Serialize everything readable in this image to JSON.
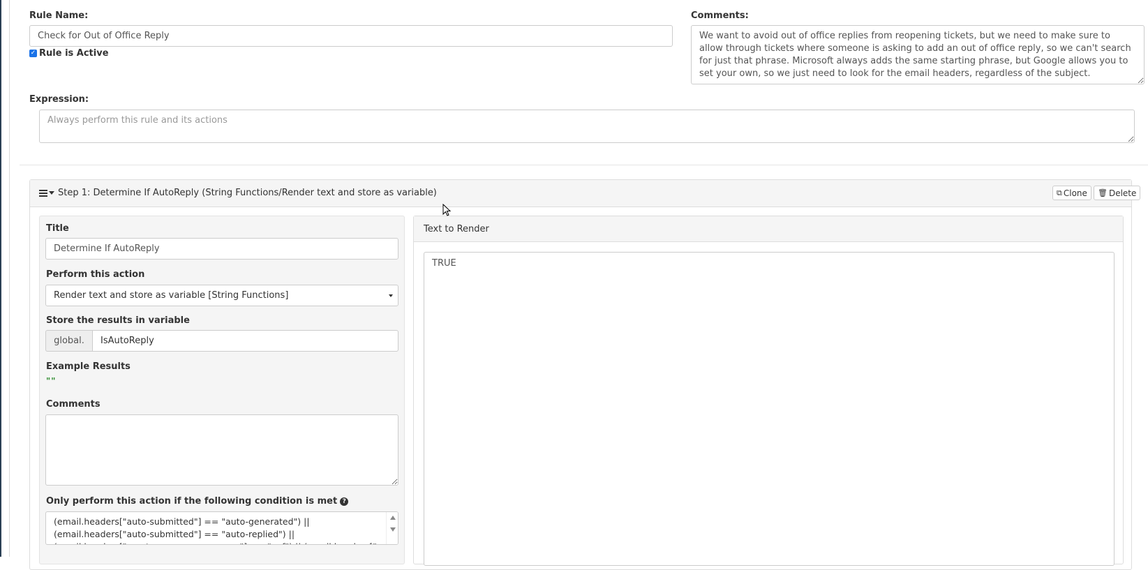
{
  "rule": {
    "name_label": "Rule Name:",
    "name_value": "Check for Out of Office Reply",
    "active_label": "Rule is Active",
    "active_checked": true,
    "comments_label": "Comments:",
    "comments_value": "We want to avoid out of office replies from reopening tickets, but we need to make sure to allow through tickets where someone is asking to add an out of office reply, so we can't search for just that phrase. Microsoft always adds the same starting phrase, but Google allows you to set your own, so we just need to look for the email headers, regardless of the subject.",
    "expression_label": "Expression:",
    "expression_placeholder": "Always perform this rule and its actions"
  },
  "step": {
    "header": "Step 1: Determine If AutoReply (String Functions/Render text and store as variable)",
    "clone_label": "Clone",
    "delete_label": "Delete",
    "title_label": "Title",
    "title_value": "Determine If AutoReply",
    "action_label": "Perform this action",
    "action_value": "Render text and store as variable [String Functions]",
    "store_label": "Store the results in variable",
    "store_prefix": "global.",
    "store_value": "IsAutoReply",
    "example_label": "Example Results",
    "example_value": "\"\"",
    "comments_label": "Comments",
    "comments_value": "",
    "condition_label": "Only perform this action if the following condition is met",
    "condition_value": "(email.headers[\"auto-submitted\"] == \"auto-generated\") ||\n(email.headers[\"auto-submitted\"] == \"auto-replied\") ||\n(email.headers[\"x-auto-response-suppress\"] == \"oof\") || (email.headers[\"precedence\"]",
    "render_header": "Text to Render",
    "render_value": "TRUE"
  },
  "icons": {
    "drag": "hamburger-icon",
    "collapse": "caret-down-icon",
    "clone": "clone-icon",
    "delete": "trash-icon",
    "help": "question-circle-icon",
    "select": "dropdown-caret-icon"
  },
  "colors": {
    "checkbox": "#1a73e8",
    "example_text": "#2e8b2e",
    "panel_bg": "#f5f5f5"
  }
}
